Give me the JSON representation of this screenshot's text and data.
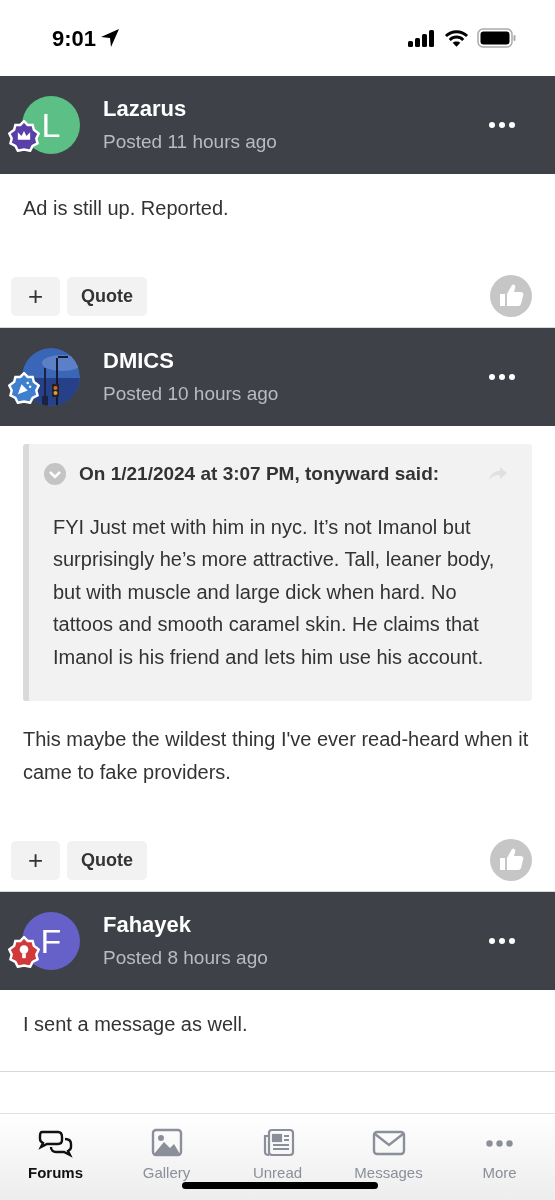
{
  "status_bar": {
    "time": "9:01"
  },
  "posts": [
    {
      "author": "Lazarus",
      "posted": "Posted 11 hours ago",
      "avatar": {
        "kind": "letter",
        "letter": "L",
        "color": "#5cbf85"
      },
      "badge": {
        "kind": "crown",
        "color": "#5b3fa8"
      },
      "body": [
        "Ad is still up. Reported."
      ],
      "actions": {
        "add": "+",
        "quote": "Quote"
      }
    },
    {
      "author": "DMICS",
      "posted": "Posted 10 hours ago",
      "badge": {
        "kind": "party",
        "color": "#3f7fd0"
      },
      "quote": {
        "header": "On 1/21/2024 at 3:07 PM, tonyward said:",
        "text": "FYI Just met with him in nyc. It’s not Imanol but surprisingly he’s more attractive. Tall, leaner body, but with muscle and large dick when hard. No tattoos and smooth caramel skin. He claims that Imanol is his friend and lets him use his account."
      },
      "body": [
        "This maybe the wildest thing I've ever read-heard when it came to fake providers."
      ],
      "actions": {
        "add": "+",
        "quote": "Quote"
      }
    },
    {
      "author": "Fahayek",
      "posted": "Posted 8 hours ago",
      "avatar": {
        "kind": "letter",
        "letter": "F",
        "color": "#6561c9"
      },
      "badge": {
        "kind": "bulb",
        "color": "#d03a3a"
      },
      "body": [
        "I sent a message as well."
      ]
    }
  ],
  "tab_bar": [
    {
      "kind": "forums",
      "label": "Forums",
      "selected": true
    },
    {
      "kind": "gallery",
      "label": "Gallery",
      "selected": false
    },
    {
      "kind": "unread",
      "label": "Unread",
      "selected": false
    },
    {
      "kind": "messages",
      "label": "Messages",
      "selected": false
    },
    {
      "kind": "more",
      "label": "More",
      "selected": false
    }
  ]
}
